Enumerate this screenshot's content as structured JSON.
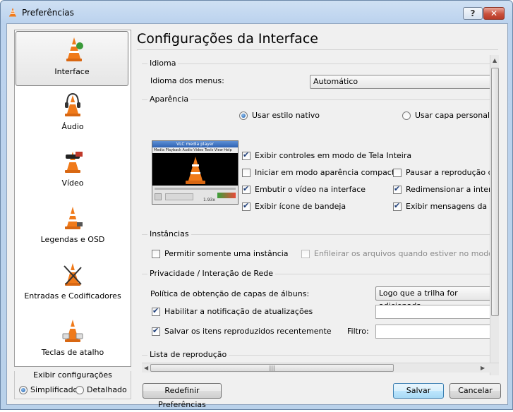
{
  "window": {
    "title": "Preferências",
    "help_label": "?",
    "close_label": "✕"
  },
  "sidebar": {
    "items": [
      {
        "label": "Interface",
        "icon": "vlc-cone-icon",
        "selected": true
      },
      {
        "label": "Áudio",
        "icon": "headphones-cone-icon",
        "selected": false
      },
      {
        "label": "Vídeo",
        "icon": "video-cone-icon",
        "selected": false
      },
      {
        "label": "Legendas e OSD",
        "icon": "subtitles-cone-icon",
        "selected": false
      },
      {
        "label": "Entradas e Codificadores",
        "icon": "codec-cone-icon",
        "selected": false
      },
      {
        "label": "Teclas de atalho",
        "icon": "hotkeys-cone-icon",
        "selected": false
      }
    ]
  },
  "show_settings": {
    "title": "Exibir configurações",
    "simple_label": "Simplificado",
    "detailed_label": "Detalhado",
    "selected": "Simplificado"
  },
  "main": {
    "title": "Configurações da Interface",
    "language": {
      "group_title": "Idioma",
      "menu_language_label": "Idioma dos menus:",
      "menu_language_value": "Automático"
    },
    "appearance": {
      "group_title": "Aparência",
      "native_style_label": "Usar estilo nativo",
      "custom_skin_label": "Usar capa personaliza",
      "native_selected": true,
      "preview": {
        "title": "VLC media player",
        "menu": "Media Playback Audio Video Tools View Help",
        "time": "1.93x"
      },
      "checkboxes": [
        {
          "label": "Exibir controles em modo de Tela Inteira",
          "checked": true
        },
        {
          "label": "Iniciar em modo aparência compacta",
          "checked": false
        },
        {
          "label": "Pausar a reprodução qua",
          "checked": false
        },
        {
          "label": "Embutir o vídeo na interface",
          "checked": true
        },
        {
          "label": "Redimensionar a interfac",
          "checked": true
        },
        {
          "label": "Exibir ícone de bandeja",
          "checked": true
        },
        {
          "label": "Exibir mensagens da ban",
          "checked": true
        }
      ]
    },
    "instances": {
      "group_title": "Instâncias",
      "single_instance_label": "Permitir somente uma instância",
      "enqueue_label": "Enfileirar os arquivos quando estiver no modo de ins",
      "single_instance_checked": false,
      "enqueue_checked": false
    },
    "privacy": {
      "group_title": "Privacidade / Interação de Rede",
      "album_art_label": "Política de obtenção de capas de álbuns:",
      "album_art_value": "Logo que a trilha for adicionada",
      "update_notify_label": "Habilitar a notificação de atualizações",
      "update_notify_checked": true,
      "recent_label": "Salvar os itens reproduzidos recentemente",
      "recent_checked": true,
      "filter_label": "Filtro:"
    },
    "playlist": {
      "group_title": "Lista de reprodução"
    },
    "hscroll_grip": "|||"
  },
  "footer": {
    "reset_label": "Redefinir Preferências",
    "save_label": "Salvar",
    "cancel_label": "Cancelar"
  },
  "colors": {
    "title_bar": "#bcd3ee",
    "cone_orange": "#f07a1a",
    "selection_blue": "#1b5aa8"
  }
}
